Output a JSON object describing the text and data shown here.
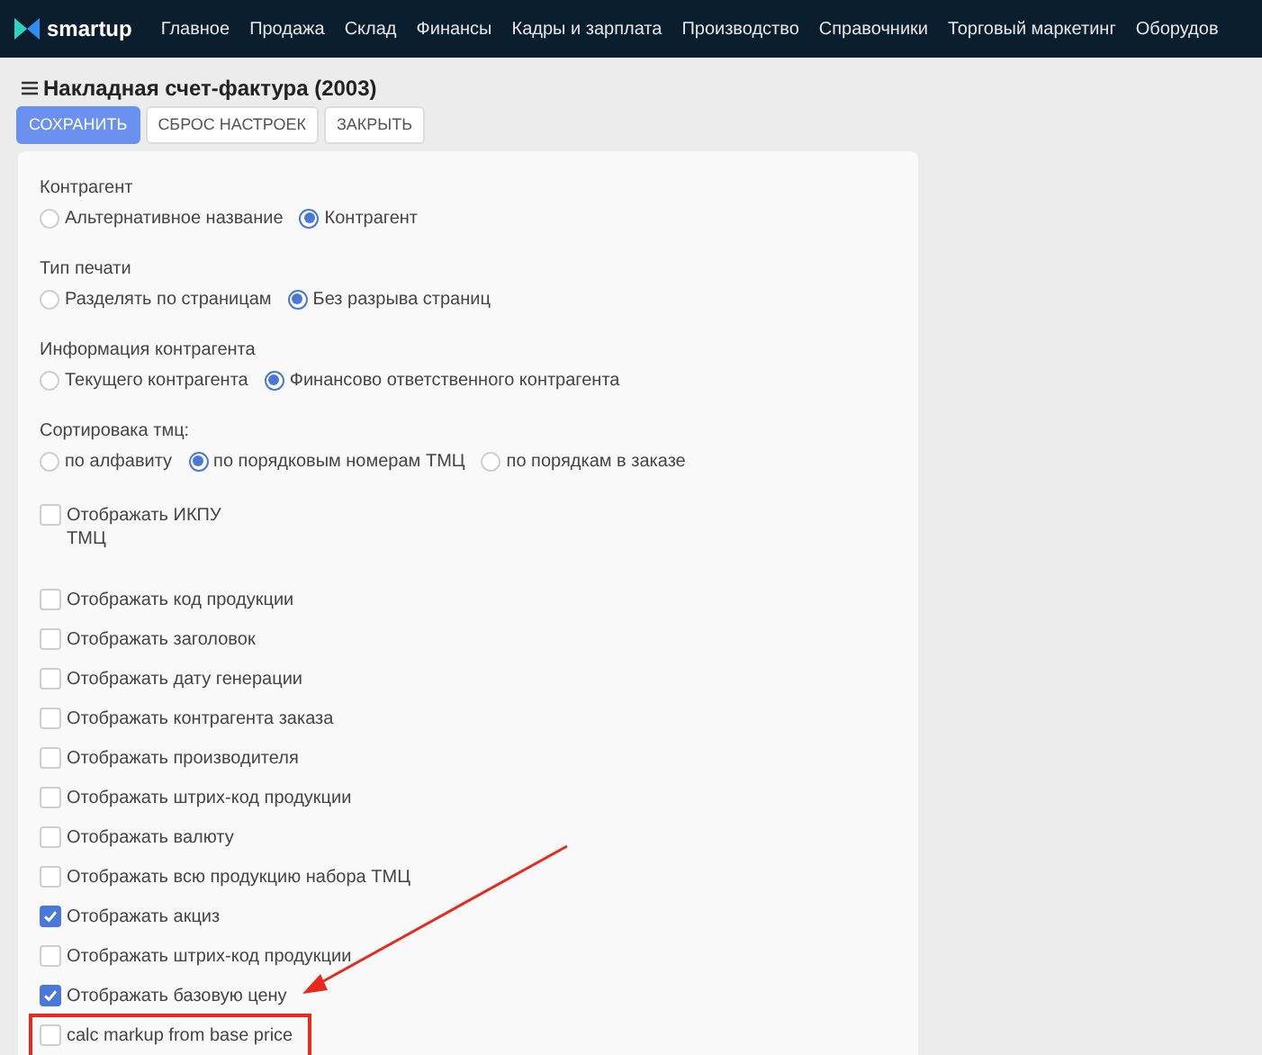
{
  "nav": {
    "brand": "smartup",
    "items": [
      "Главное",
      "Продажа",
      "Склад",
      "Финансы",
      "Кадры и зарплата",
      "Производство",
      "Справочники",
      "Торговый маркетинг",
      "Оборудов"
    ]
  },
  "page": {
    "title": "Накладная счет-фактура (2003)"
  },
  "buttons": [
    {
      "label": "СОХРАНИТЬ",
      "kind": "primary"
    },
    {
      "label": "СБРОС НАСТРОЕК",
      "kind": "default"
    },
    {
      "label": "ЗАКРЫТЬ",
      "kind": "default"
    }
  ],
  "radio_groups": [
    {
      "label": "Контрагент",
      "options": [
        {
          "label": "Альтернативное название",
          "selected": false
        },
        {
          "label": "Контрагент",
          "selected": true
        }
      ]
    },
    {
      "label": "Тип печати",
      "options": [
        {
          "label": "Разделять по страницам",
          "selected": false
        },
        {
          "label": "Без разрыва страниц",
          "selected": true
        }
      ]
    },
    {
      "label": "Информация контрагента",
      "options": [
        {
          "label": "Текущего контрагента",
          "selected": false
        },
        {
          "label": "Финансово ответственного контрагента",
          "selected": true
        }
      ]
    },
    {
      "label": "Сортировака тмц:",
      "options": [
        {
          "label": "по алфавиту",
          "selected": false
        },
        {
          "label": "по порядковым номерам ТМЦ",
          "selected": true
        },
        {
          "label": "по порядкам в заказе",
          "selected": false
        }
      ]
    }
  ],
  "checkbox_first": {
    "lines": [
      "Отображать ИКПУ",
      "ТМЦ"
    ],
    "checked": false
  },
  "checkboxes": [
    {
      "label": "Отображать код продукции",
      "checked": false,
      "highlighted": false
    },
    {
      "label": "Отображать заголовок",
      "checked": false,
      "highlighted": false
    },
    {
      "label": "Отображать дату генерации",
      "checked": false,
      "highlighted": false
    },
    {
      "label": "Отображать контрагента заказа",
      "checked": false,
      "highlighted": false
    },
    {
      "label": "Отображать производителя",
      "checked": false,
      "highlighted": false
    },
    {
      "label": "Отображать штрих-код продукции",
      "checked": false,
      "highlighted": false
    },
    {
      "label": "Отображать валюту",
      "checked": false,
      "highlighted": false
    },
    {
      "label": "Отображать всю продукцию набора ТМЦ",
      "checked": false,
      "highlighted": false
    },
    {
      "label": "Отображать акциз",
      "checked": true,
      "highlighted": false
    },
    {
      "label": "Отображать штрих-код продукции",
      "checked": false,
      "highlighted": false
    },
    {
      "label": "Отображать базовую цену",
      "checked": true,
      "highlighted": false
    },
    {
      "label": "calc markup from base price",
      "checked": false,
      "highlighted": true
    }
  ]
}
